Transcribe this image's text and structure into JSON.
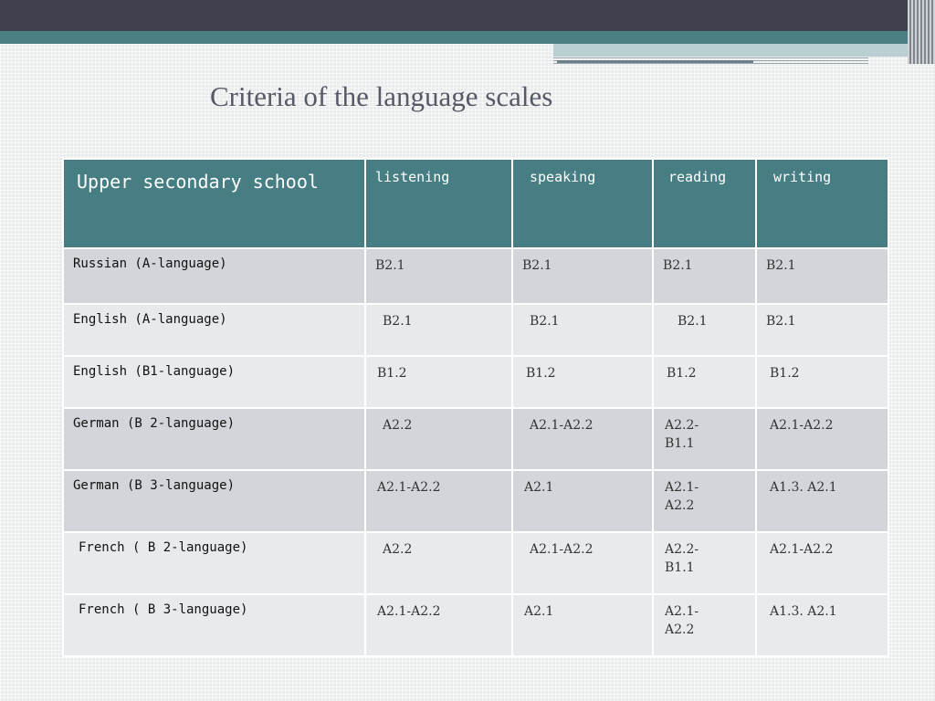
{
  "slide": {
    "title": "Criteria of the language scales"
  },
  "table": {
    "corner_header": "Upper secondary school",
    "skills": [
      "listening",
      "speaking",
      "reading",
      "writing"
    ],
    "rows": [
      {
        "language": "Russian (A-language)",
        "levels": [
          "B2.1",
          "B2.1",
          "B2.1",
          "B2.1"
        ]
      },
      {
        "language": "English (A-language)",
        "levels": [
          "B2.1",
          "B2.1",
          "B2.1",
          "B2.1"
        ]
      },
      {
        "language": "English (B1-language)",
        "levels": [
          "B1.2",
          "B1.2",
          "B1.2",
          "B1.2"
        ]
      },
      {
        "language": "German (B 2-language)",
        "levels": [
          "A2.2",
          "A2.1-A2.2",
          "A2.2- B1.1",
          "A2.1-A2.2"
        ]
      },
      {
        "language": "German (B 3-language)",
        "levels": [
          "A2.1-A2.2",
          "A2.1",
          "A2.1- A2.2",
          "A1.3. A2.1"
        ]
      },
      {
        "language": "French ( B 2-language)",
        "levels": [
          "A2.2",
          "A2.1-A2.2",
          "A2.2- B1.1",
          "A2.1-A2.2"
        ]
      },
      {
        "language": "French ( B 3-language)",
        "levels": [
          "A2.1-A2.2",
          "A2.1",
          "A2.1- A2.2",
          "A1.3. A2.1"
        ]
      }
    ]
  },
  "colors": {
    "header_bg": "#467e83",
    "top_band": "#40414f",
    "title_text": "#555a66"
  }
}
